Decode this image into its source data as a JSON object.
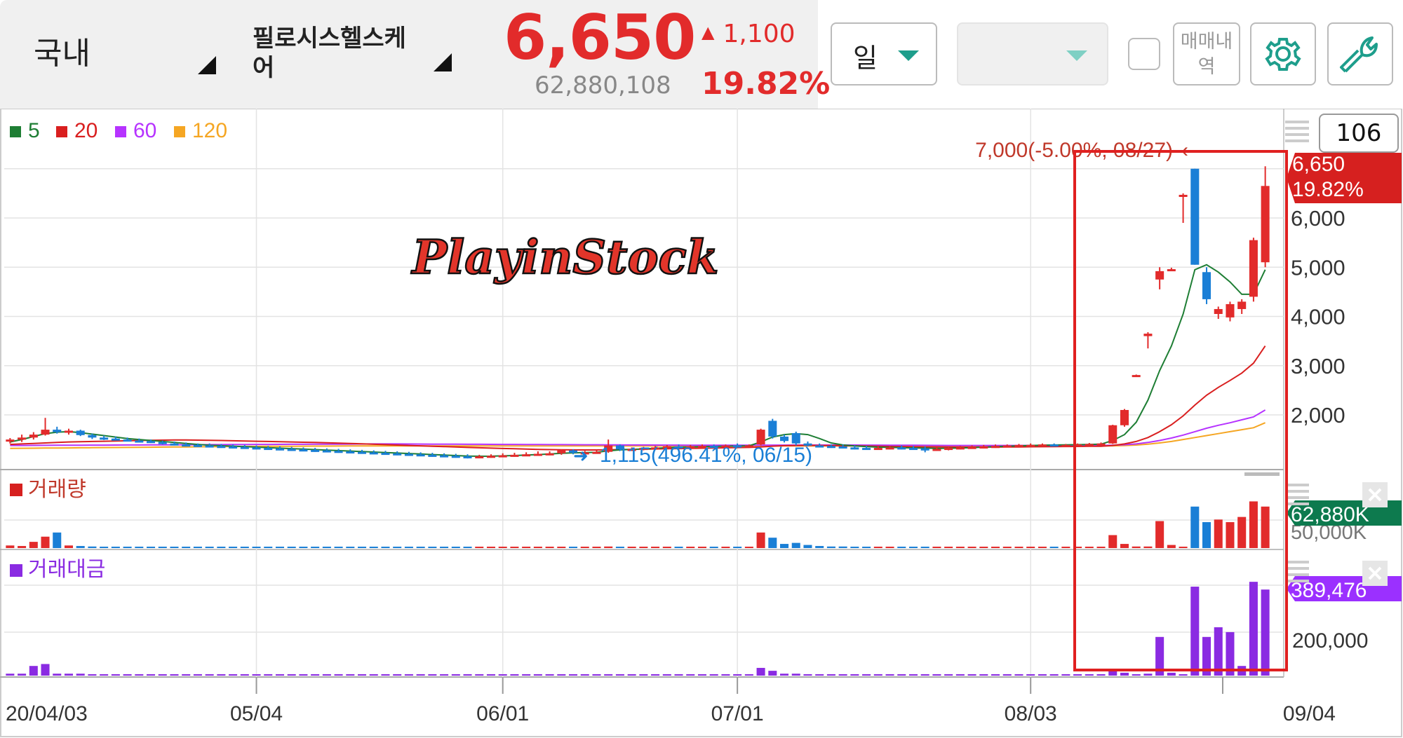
{
  "header": {
    "market": "국내",
    "stock_name": "필로시스헬스케어",
    "price": "6,650",
    "change": "1,100",
    "change_arrow": "▲",
    "volume": "62,880,108",
    "change_pct": "19.82%",
    "period": "일",
    "trade_history": "매매내역",
    "colors": {
      "up": "#e22b2b",
      "down": "#1a7fd6",
      "accent": "#1e9e8c"
    }
  },
  "chart_data": {
    "type": "candlestick",
    "ma_legend": [
      {
        "label": "5",
        "color": "#1e7e34"
      },
      {
        "label": "20",
        "color": "#d91f1f"
      },
      {
        "label": "60",
        "color": "#b633ff"
      },
      {
        "label": "120",
        "color": "#f5a623"
      }
    ],
    "x_ticks": [
      "20/04/03",
      "05/04",
      "06/01",
      "07/01",
      "08/03",
      "09/04"
    ],
    "y_ticks": [
      "6,000",
      "5,000",
      "4,000",
      "3,000",
      "2,000"
    ],
    "y_range": [
      500,
      7000
    ],
    "visible_count": "106",
    "watermark": "PlayinStock",
    "high_label": "7,000(-5.00%, 08/27)",
    "low_label": "1,115(496.41%, 06/15)",
    "last_price": "6,650",
    "last_pct": "19.82%",
    "volume_panel": {
      "title": "거래량",
      "tick": "50,000K",
      "last": "62,880K"
    },
    "amount_panel": {
      "title": "거래대금",
      "tick": "200,000",
      "last": "389,476"
    },
    "candles": [
      {
        "o": 1470,
        "h": 1530,
        "l": 1420,
        "c": 1500
      },
      {
        "o": 1500,
        "h": 1600,
        "l": 1450,
        "c": 1540
      },
      {
        "o": 1540,
        "h": 1650,
        "l": 1500,
        "c": 1600
      },
      {
        "o": 1600,
        "h": 1940,
        "l": 1580,
        "c": 1700
      },
      {
        "o": 1700,
        "h": 1760,
        "l": 1620,
        "c": 1650
      },
      {
        "o": 1650,
        "h": 1720,
        "l": 1600,
        "c": 1680
      },
      {
        "o": 1680,
        "h": 1700,
        "l": 1570,
        "c": 1590
      },
      {
        "o": 1590,
        "h": 1620,
        "l": 1510,
        "c": 1540
      },
      {
        "o": 1540,
        "h": 1580,
        "l": 1490,
        "c": 1520
      },
      {
        "o": 1520,
        "h": 1560,
        "l": 1480,
        "c": 1500
      },
      {
        "o": 1500,
        "h": 1540,
        "l": 1460,
        "c": 1480
      },
      {
        "o": 1480,
        "h": 1520,
        "l": 1440,
        "c": 1470
      },
      {
        "o": 1470,
        "h": 1500,
        "l": 1430,
        "c": 1450
      },
      {
        "o": 1450,
        "h": 1480,
        "l": 1400,
        "c": 1420
      },
      {
        "o": 1420,
        "h": 1460,
        "l": 1380,
        "c": 1400
      },
      {
        "o": 1400,
        "h": 1440,
        "l": 1360,
        "c": 1390
      },
      {
        "o": 1390,
        "h": 1420,
        "l": 1350,
        "c": 1380
      },
      {
        "o": 1380,
        "h": 1420,
        "l": 1340,
        "c": 1370
      },
      {
        "o": 1370,
        "h": 1410,
        "l": 1330,
        "c": 1360
      },
      {
        "o": 1360,
        "h": 1400,
        "l": 1320,
        "c": 1350
      },
      {
        "o": 1350,
        "h": 1390,
        "l": 1310,
        "c": 1340
      },
      {
        "o": 1340,
        "h": 1380,
        "l": 1300,
        "c": 1330
      },
      {
        "o": 1330,
        "h": 1370,
        "l": 1290,
        "c": 1320
      },
      {
        "o": 1320,
        "h": 1360,
        "l": 1280,
        "c": 1310
      },
      {
        "o": 1310,
        "h": 1350,
        "l": 1270,
        "c": 1300
      },
      {
        "o": 1300,
        "h": 1340,
        "l": 1260,
        "c": 1290
      },
      {
        "o": 1290,
        "h": 1330,
        "l": 1250,
        "c": 1280
      },
      {
        "o": 1280,
        "h": 1320,
        "l": 1240,
        "c": 1270
      },
      {
        "o": 1270,
        "h": 1310,
        "l": 1230,
        "c": 1260
      },
      {
        "o": 1260,
        "h": 1300,
        "l": 1220,
        "c": 1250
      },
      {
        "o": 1250,
        "h": 1290,
        "l": 1210,
        "c": 1240
      },
      {
        "o": 1240,
        "h": 1280,
        "l": 1200,
        "c": 1230
      },
      {
        "o": 1230,
        "h": 1270,
        "l": 1190,
        "c": 1220
      },
      {
        "o": 1220,
        "h": 1260,
        "l": 1180,
        "c": 1210
      },
      {
        "o": 1210,
        "h": 1250,
        "l": 1170,
        "c": 1200
      },
      {
        "o": 1200,
        "h": 1240,
        "l": 1160,
        "c": 1190
      },
      {
        "o": 1190,
        "h": 1230,
        "l": 1150,
        "c": 1180
      },
      {
        "o": 1180,
        "h": 1220,
        "l": 1140,
        "c": 1170
      },
      {
        "o": 1170,
        "h": 1210,
        "l": 1130,
        "c": 1160
      },
      {
        "o": 1160,
        "h": 1200,
        "l": 1115,
        "c": 1150
      },
      {
        "o": 1150,
        "h": 1190,
        "l": 1120,
        "c": 1160
      },
      {
        "o": 1160,
        "h": 1200,
        "l": 1130,
        "c": 1170
      },
      {
        "o": 1170,
        "h": 1220,
        "l": 1140,
        "c": 1180
      },
      {
        "o": 1180,
        "h": 1230,
        "l": 1150,
        "c": 1190
      },
      {
        "o": 1190,
        "h": 1240,
        "l": 1160,
        "c": 1200
      },
      {
        "o": 1200,
        "h": 1260,
        "l": 1170,
        "c": 1210
      },
      {
        "o": 1210,
        "h": 1260,
        "l": 1180,
        "c": 1220
      },
      {
        "o": 1220,
        "h": 1300,
        "l": 1190,
        "c": 1280
      },
      {
        "o": 1280,
        "h": 1300,
        "l": 1200,
        "c": 1230
      },
      {
        "o": 1230,
        "h": 1270,
        "l": 1200,
        "c": 1240
      },
      {
        "o": 1240,
        "h": 1280,
        "l": 1210,
        "c": 1250
      },
      {
        "o": 1250,
        "h": 1500,
        "l": 1230,
        "c": 1380
      },
      {
        "o": 1380,
        "h": 1400,
        "l": 1280,
        "c": 1300
      },
      {
        "o": 1300,
        "h": 1340,
        "l": 1270,
        "c": 1310
      },
      {
        "o": 1310,
        "h": 1350,
        "l": 1280,
        "c": 1330
      },
      {
        "o": 1330,
        "h": 1370,
        "l": 1290,
        "c": 1340
      },
      {
        "o": 1340,
        "h": 1390,
        "l": 1310,
        "c": 1360
      },
      {
        "o": 1360,
        "h": 1400,
        "l": 1320,
        "c": 1350
      },
      {
        "o": 1350,
        "h": 1390,
        "l": 1320,
        "c": 1360
      },
      {
        "o": 1360,
        "h": 1400,
        "l": 1330,
        "c": 1370
      },
      {
        "o": 1370,
        "h": 1400,
        "l": 1330,
        "c": 1360
      },
      {
        "o": 1360,
        "h": 1400,
        "l": 1330,
        "c": 1380
      },
      {
        "o": 1380,
        "h": 1420,
        "l": 1340,
        "c": 1370
      },
      {
        "o": 1370,
        "h": 1400,
        "l": 1340,
        "c": 1380
      },
      {
        "o": 1400,
        "h": 1720,
        "l": 1380,
        "c": 1700
      },
      {
        "o": 1880,
        "h": 1920,
        "l": 1520,
        "c": 1560
      },
      {
        "o": 1560,
        "h": 1600,
        "l": 1440,
        "c": 1470
      },
      {
        "o": 1630,
        "h": 1660,
        "l": 1380,
        "c": 1420
      },
      {
        "o": 1420,
        "h": 1460,
        "l": 1360,
        "c": 1380
      },
      {
        "o": 1380,
        "h": 1420,
        "l": 1340,
        "c": 1370
      },
      {
        "o": 1370,
        "h": 1400,
        "l": 1330,
        "c": 1360
      },
      {
        "o": 1360,
        "h": 1400,
        "l": 1320,
        "c": 1340
      },
      {
        "o": 1340,
        "h": 1380,
        "l": 1300,
        "c": 1330
      },
      {
        "o": 1330,
        "h": 1370,
        "l": 1290,
        "c": 1320
      },
      {
        "o": 1320,
        "h": 1360,
        "l": 1290,
        "c": 1330
      },
      {
        "o": 1330,
        "h": 1370,
        "l": 1300,
        "c": 1340
      },
      {
        "o": 1340,
        "h": 1380,
        "l": 1300,
        "c": 1330
      },
      {
        "o": 1330,
        "h": 1370,
        "l": 1290,
        "c": 1320
      },
      {
        "o": 1320,
        "h": 1360,
        "l": 1240,
        "c": 1300
      },
      {
        "o": 1300,
        "h": 1340,
        "l": 1270,
        "c": 1310
      },
      {
        "o": 1310,
        "h": 1350,
        "l": 1280,
        "c": 1330
      },
      {
        "o": 1330,
        "h": 1370,
        "l": 1300,
        "c": 1340
      },
      {
        "o": 1340,
        "h": 1380,
        "l": 1310,
        "c": 1350
      },
      {
        "o": 1350,
        "h": 1390,
        "l": 1320,
        "c": 1360
      },
      {
        "o": 1360,
        "h": 1400,
        "l": 1330,
        "c": 1370
      },
      {
        "o": 1370,
        "h": 1400,
        "l": 1340,
        "c": 1380
      },
      {
        "o": 1380,
        "h": 1410,
        "l": 1350,
        "c": 1390
      },
      {
        "o": 1380,
        "h": 1420,
        "l": 1350,
        "c": 1390
      },
      {
        "o": 1390,
        "h": 1420,
        "l": 1360,
        "c": 1400
      },
      {
        "o": 1400,
        "h": 1420,
        "l": 1370,
        "c": 1380
      },
      {
        "o": 1380,
        "h": 1410,
        "l": 1350,
        "c": 1390
      },
      {
        "o": 1390,
        "h": 1420,
        "l": 1360,
        "c": 1400
      },
      {
        "o": 1400,
        "h": 1430,
        "l": 1370,
        "c": 1410
      },
      {
        "o": 1410,
        "h": 1440,
        "l": 1380,
        "c": 1420
      },
      {
        "o": 1420,
        "h": 1800,
        "l": 1410,
        "c": 1790
      },
      {
        "o": 1790,
        "h": 2120,
        "l": 1760,
        "c": 2100
      },
      {
        "o": 2800,
        "h": 2820,
        "l": 2780,
        "c": 2810
      },
      {
        "o": 3600,
        "h": 3680,
        "l": 3350,
        "c": 3650
      },
      {
        "o": 4750,
        "h": 5000,
        "l": 4550,
        "c": 4920
      },
      {
        "o": 4950,
        "h": 4990,
        "l": 4930,
        "c": 4960
      },
      {
        "o": 6450,
        "h": 6500,
        "l": 5900,
        "c": 6470
      },
      {
        "o": 7000,
        "h": 7000,
        "l": 5050,
        "c": 5050
      },
      {
        "o": 4900,
        "h": 5000,
        "l": 4250,
        "c": 4350
      },
      {
        "o": 4050,
        "h": 4200,
        "l": 3950,
        "c": 4150
      },
      {
        "o": 3980,
        "h": 4300,
        "l": 3900,
        "c": 4250
      },
      {
        "o": 4150,
        "h": 4350,
        "l": 4050,
        "c": 4300
      },
      {
        "o": 4400,
        "h": 5600,
        "l": 4300,
        "c": 5550
      },
      {
        "o": 5100,
        "h": 7050,
        "l": 5000,
        "c": 6650
      }
    ],
    "ma5": [
      1450,
      1500,
      1560,
      1620,
      1650,
      1660,
      1640,
      1610,
      1580,
      1550,
      1520,
      1500,
      1480,
      1460,
      1440,
      1420,
      1400,
      1385,
      1375,
      1365,
      1355,
      1345,
      1335,
      1325,
      1315,
      1305,
      1295,
      1285,
      1275,
      1265,
      1255,
      1245,
      1235,
      1225,
      1215,
      1205,
      1195,
      1185,
      1175,
      1165,
      1160,
      1162,
      1168,
      1175,
      1185,
      1195,
      1205,
      1220,
      1230,
      1235,
      1240,
      1270,
      1290,
      1300,
      1310,
      1320,
      1335,
      1345,
      1350,
      1355,
      1360,
      1365,
      1370,
      1372,
      1450,
      1550,
      1600,
      1620,
      1600,
      1520,
      1430,
      1390,
      1370,
      1355,
      1345,
      1340,
      1335,
      1330,
      1325,
      1320,
      1322,
      1328,
      1335,
      1345,
      1355,
      1365,
      1372,
      1380,
      1385,
      1390,
      1392,
      1395,
      1400,
      1405,
      1480,
      1600,
      1850,
      2300,
      2900,
      3400,
      4050,
      4950,
      5050,
      4900,
      4700,
      4450,
      4450,
      4950
    ],
    "ma20": [
      1400,
      1410,
      1420,
      1430,
      1440,
      1450,
      1455,
      1460,
      1465,
      1470,
      1475,
      1480,
      1485,
      1488,
      1490,
      1490,
      1488,
      1485,
      1480,
      1475,
      1470,
      1465,
      1460,
      1455,
      1450,
      1445,
      1440,
      1435,
      1428,
      1420,
      1412,
      1404,
      1396,
      1388,
      1380,
      1372,
      1364,
      1356,
      1348,
      1340,
      1332,
      1325,
      1318,
      1312,
      1306,
      1300,
      1296,
      1292,
      1290,
      1288,
      1288,
      1292,
      1296,
      1300,
      1304,
      1308,
      1312,
      1316,
      1320,
      1324,
      1328,
      1332,
      1336,
      1340,
      1350,
      1365,
      1375,
      1380,
      1382,
      1380,
      1378,
      1375,
      1372,
      1368,
      1364,
      1360,
      1356,
      1352,
      1350,
      1348,
      1346,
      1345,
      1345,
      1346,
      1347,
      1348,
      1350,
      1352,
      1354,
      1356,
      1358,
      1360,
      1362,
      1364,
      1380,
      1410,
      1460,
      1540,
      1660,
      1800,
      1980,
      2200,
      2400,
      2560,
      2700,
      2850,
      3050,
      3400
    ],
    "ma60": [
      1380,
      1380,
      1381,
      1382,
      1383,
      1384,
      1385,
      1386,
      1387,
      1388,
      1389,
      1390,
      1391,
      1392,
      1393,
      1394,
      1395,
      1396,
      1397,
      1398,
      1399,
      1400,
      1401,
      1402,
      1403,
      1404,
      1405,
      1406,
      1407,
      1408,
      1409,
      1410,
      1410,
      1410,
      1409,
      1408,
      1407,
      1406,
      1405,
      1404,
      1403,
      1402,
      1401,
      1400,
      1399,
      1398,
      1397,
      1396,
      1395,
      1394,
      1393,
      1392,
      1391,
      1390,
      1389,
      1388,
      1387,
      1386,
      1385,
      1384,
      1384,
      1384,
      1384,
      1384,
      1385,
      1386,
      1387,
      1388,
      1388,
      1388,
      1388,
      1388,
      1388,
      1387,
      1386,
      1385,
      1384,
      1383,
      1382,
      1381,
      1380,
      1380,
      1380,
      1380,
      1380,
      1380,
      1380,
      1380,
      1380,
      1380,
      1380,
      1380,
      1380,
      1380,
      1385,
      1395,
      1410,
      1440,
      1480,
      1530,
      1590,
      1660,
      1730,
      1790,
      1840,
      1900,
      1960,
      2100
    ],
    "ma120": [
      1320,
      1322,
      1324,
      1326,
      1328,
      1330,
      1332,
      1334,
      1336,
      1338,
      1340,
      1342,
      1344,
      1346,
      1348,
      1350,
      1352,
      1354,
      1356,
      1358,
      1360,
      1361,
      1362,
      1363,
      1364,
      1365,
      1366,
      1367,
      1368,
      1369,
      1370,
      1370,
      1370,
      1370,
      1370,
      1370,
      1370,
      1370,
      1370,
      1370,
      1370,
      1370,
      1370,
      1370,
      1370,
      1370,
      1370,
      1370,
      1370,
      1370,
      1370,
      1370,
      1370,
      1370,
      1370,
      1370,
      1370,
      1370,
      1370,
      1370,
      1370,
      1370,
      1370,
      1370,
      1370,
      1370,
      1370,
      1370,
      1370,
      1370,
      1370,
      1370,
      1370,
      1370,
      1370,
      1370,
      1370,
      1370,
      1370,
      1370,
      1370,
      1370,
      1370,
      1370,
      1370,
      1370,
      1370,
      1370,
      1370,
      1370,
      1370,
      1370,
      1370,
      1370,
      1372,
      1378,
      1388,
      1405,
      1430,
      1460,
      1500,
      1540,
      1580,
      1620,
      1660,
      1700,
      1740,
      1840
    ],
    "volume_pct": [
      5,
      4,
      12,
      22,
      30,
      5,
      4,
      3,
      2,
      2,
      2,
      2,
      2,
      1,
      1,
      1,
      1,
      1,
      1,
      1,
      1,
      1,
      1,
      1,
      1,
      1,
      1,
      1,
      1,
      1,
      1,
      1,
      1,
      1,
      1,
      1,
      1,
      1,
      1,
      1,
      1,
      1,
      1,
      1,
      1,
      1,
      1,
      1,
      1,
      1,
      1,
      3,
      2,
      1,
      1,
      1,
      1,
      1,
      1,
      1,
      1,
      1,
      1,
      1,
      30,
      20,
      8,
      10,
      6,
      4,
      3,
      3,
      2,
      2,
      2,
      2,
      2,
      2,
      2,
      2,
      2,
      2,
      2,
      2,
      2,
      2,
      2,
      2,
      2,
      2,
      2,
      2,
      2,
      2,
      25,
      8,
      3,
      3,
      52,
      6,
      2,
      80,
      50,
      55,
      50,
      60,
      90,
      80
    ],
    "amount_pct": [
      2,
      2,
      10,
      12,
      2,
      2,
      2,
      1,
      1,
      1,
      1,
      1,
      1,
      1,
      1,
      1,
      1,
      1,
      1,
      1,
      1,
      1,
      1,
      1,
      1,
      1,
      1,
      1,
      1,
      1,
      1,
      1,
      1,
      1,
      1,
      1,
      1,
      1,
      1,
      1,
      1,
      1,
      1,
      1,
      1,
      1,
      1,
      1,
      1,
      1,
      1,
      1,
      1,
      1,
      1,
      1,
      1,
      1,
      1,
      1,
      1,
      1,
      1,
      1,
      8,
      5,
      2,
      2,
      1,
      1,
      1,
      1,
      1,
      1,
      1,
      1,
      1,
      1,
      1,
      1,
      1,
      1,
      1,
      1,
      1,
      1,
      1,
      1,
      1,
      1,
      1,
      1,
      1,
      1,
      5,
      3,
      1,
      2,
      40,
      3,
      1,
      92,
      40,
      50,
      45,
      10,
      97,
      89
    ]
  }
}
